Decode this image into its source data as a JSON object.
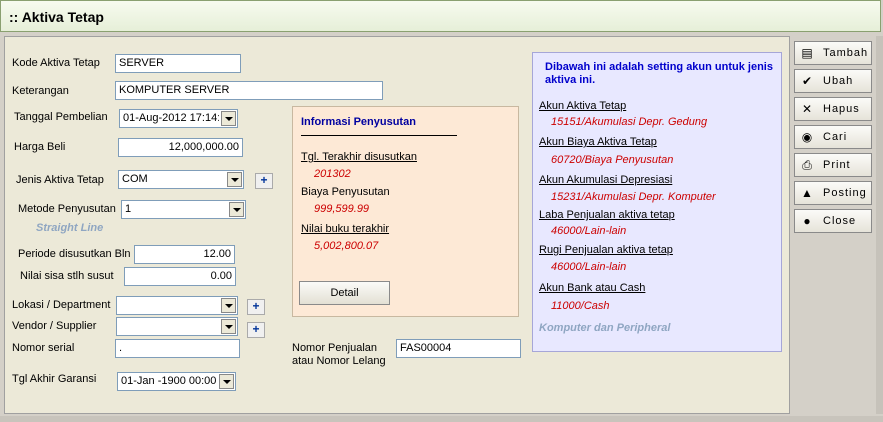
{
  "window": {
    "title": ":: Aktiva Tetap"
  },
  "form": {
    "kode_label": "Kode Aktiva Tetap",
    "kode_value": "SERVER",
    "keterangan_label": "Keterangan",
    "keterangan_value": "KOMPUTER SERVER",
    "tanggal_label": "Tanggal Pembelian",
    "tanggal_value": "01-Aug-2012 17:14:",
    "harga_label": "Harga Beli",
    "harga_value": "12,000,000.00",
    "jenis_label": "Jenis Aktiva Tetap",
    "jenis_value": "COM",
    "metode_label": "Metode Penyusutan",
    "metode_value": "1",
    "metode_note": "Straight Line",
    "periode_label": "Periode disusutkan Bln",
    "periode_value": "12.00",
    "nilai_sisa_label": "Nilai sisa stlh susut",
    "nilai_sisa_value": "0.00",
    "lokasi_label": "Lokasi / Department",
    "lokasi_value": "",
    "vendor_label": "Vendor / Supplier",
    "vendor_value": "",
    "serial_label": "Nomor serial",
    "serial_value": ".",
    "garansi_label": "Tgl Akhir Garansi",
    "garansi_value": "01-Jan -1900 00:00:",
    "penjualan_label_1": "Nomor Penjualan",
    "penjualan_label_2": "atau Nomor Lelang",
    "penjualan_value": "FAS00004",
    "plus_glyph": "+"
  },
  "info": {
    "title": "Informasi Penyusutan",
    "tgl_label": "Tgl. Terakhir disusutkan",
    "tgl_value": "201302",
    "biaya_label": "Biaya Penyusutan",
    "biaya_value": "999,599.99",
    "nilai_label": "Nilai buku terakhir",
    "nilai_value": "5,002,800.07",
    "detail_button": "Detail"
  },
  "setting": {
    "header": "Dibawah ini adalah setting akun untuk jenis aktiva ini.",
    "items": [
      {
        "label": "Akun Aktiva Tetap",
        "value": "15151/Akumulasi Depr. Gedung"
      },
      {
        "label": "Akun Biaya Aktiva Tetap",
        "value": "60720/Biaya Penyusutan"
      },
      {
        "label": "Akun Akumulasi Depresiasi",
        "value": "15231/Akumulasi Depr. Komputer"
      },
      {
        "label": "Laba Penjualan aktiva tetap",
        "value": "46000/Lain-lain"
      },
      {
        "label": "Rugi Penjualan aktiva tetap",
        "value": "46000/Lain-lain"
      },
      {
        "label": "Akun Bank atau Cash",
        "value": "11000/Cash"
      }
    ],
    "footer": "Komputer dan Peripheral"
  },
  "toolbar": {
    "tambah": "Tambah",
    "ubah": "Ubah",
    "hapus": "Hapus",
    "cari": "Cari",
    "print": "Print",
    "posting": "Posting",
    "close": "Close"
  }
}
